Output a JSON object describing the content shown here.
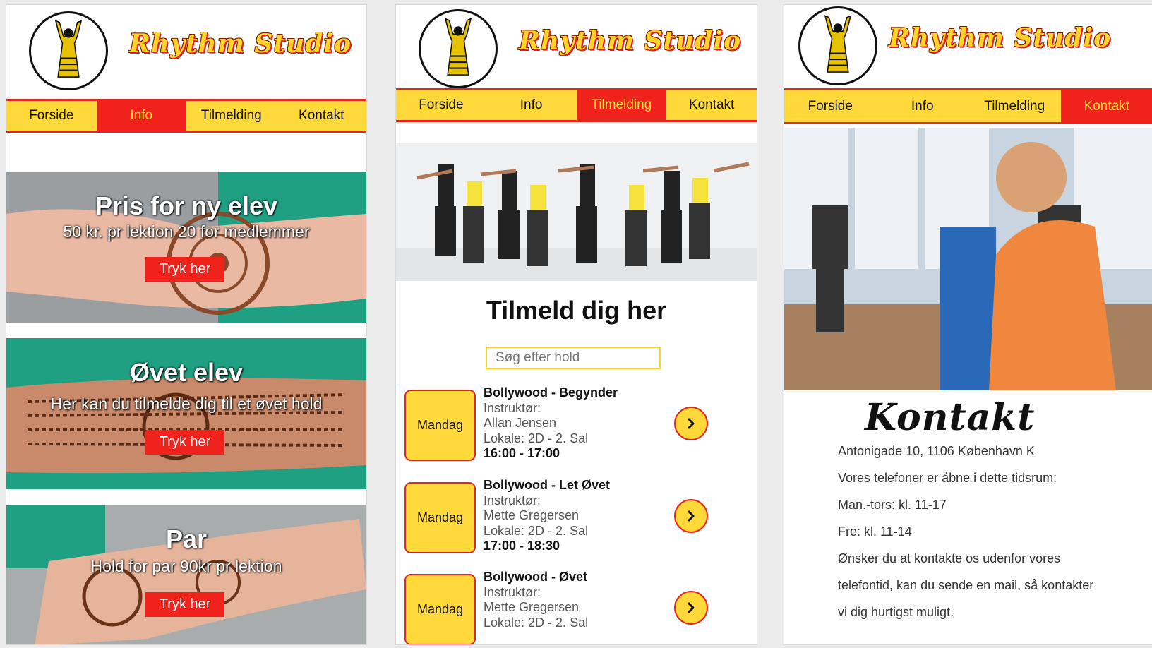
{
  "brand": {
    "name": "Rhythm Studio"
  },
  "colors": {
    "accent_yellow": "#ffd83a",
    "accent_red": "#f0221c"
  },
  "nav": {
    "items": [
      "Forside",
      "Info",
      "Tilmelding",
      "Kontakt"
    ]
  },
  "info_page": {
    "active_tab": "Info",
    "cards": [
      {
        "title": "Pris for ny elev",
        "subtitle": "50 kr. pr lektion 20 for medlemmer",
        "button": "Tryk her"
      },
      {
        "title": "Øvet elev",
        "subtitle": "Her kan du tilmelde dig til et øvet hold",
        "button": "Tryk her"
      },
      {
        "title": "Par",
        "subtitle": "Hold for par 90kr pr lektion",
        "button": "Tryk her"
      }
    ]
  },
  "signup_page": {
    "active_tab": "Tilmelding",
    "title": "Tilmeld dig her",
    "search_placeholder": "Søg efter hold",
    "classes": [
      {
        "day": "Mandag",
        "name": "Bollywood - Begynder",
        "instructor_label": "Instruktør:",
        "instructor": "Allan Jensen",
        "location": "Lokale: 2D - 2. Sal",
        "time": "16:00 - 17:00",
        "arrow": "chevron-right-icon"
      },
      {
        "day": "Mandag",
        "name": "Bollywood - Let Øvet",
        "instructor_label": "Instruktør:",
        "instructor": "Mette Gregersen",
        "location": "Lokale: 2D - 2. Sal",
        "time": "17:00 - 18:30",
        "arrow": "chevron-right-icon"
      },
      {
        "day": "Mandag",
        "name": "Bollywood - Øvet",
        "instructor_label": "Instruktør:",
        "instructor": "Mette Gregersen",
        "location": "Lokale: 2D - 2. Sal",
        "time": "",
        "arrow": "chevron-right-icon"
      }
    ]
  },
  "contact_page": {
    "active_tab": "Kontakt",
    "title": "Kontakt",
    "address": "Antonigade 10, 1106 København K",
    "phone_intro": "Vores telefoner er åbne i dette tidsrum:",
    "hours_weekdays": "Man.-tors: kl. 11-17",
    "hours_friday": "Fre: kl. 11-14",
    "mail_text_1": "Ønsker du at kontakte os udenfor vores",
    "mail_text_2": "telefontid, kan du sende en mail, så kontakter",
    "mail_text_3": "vi dig hurtigst muligt."
  }
}
